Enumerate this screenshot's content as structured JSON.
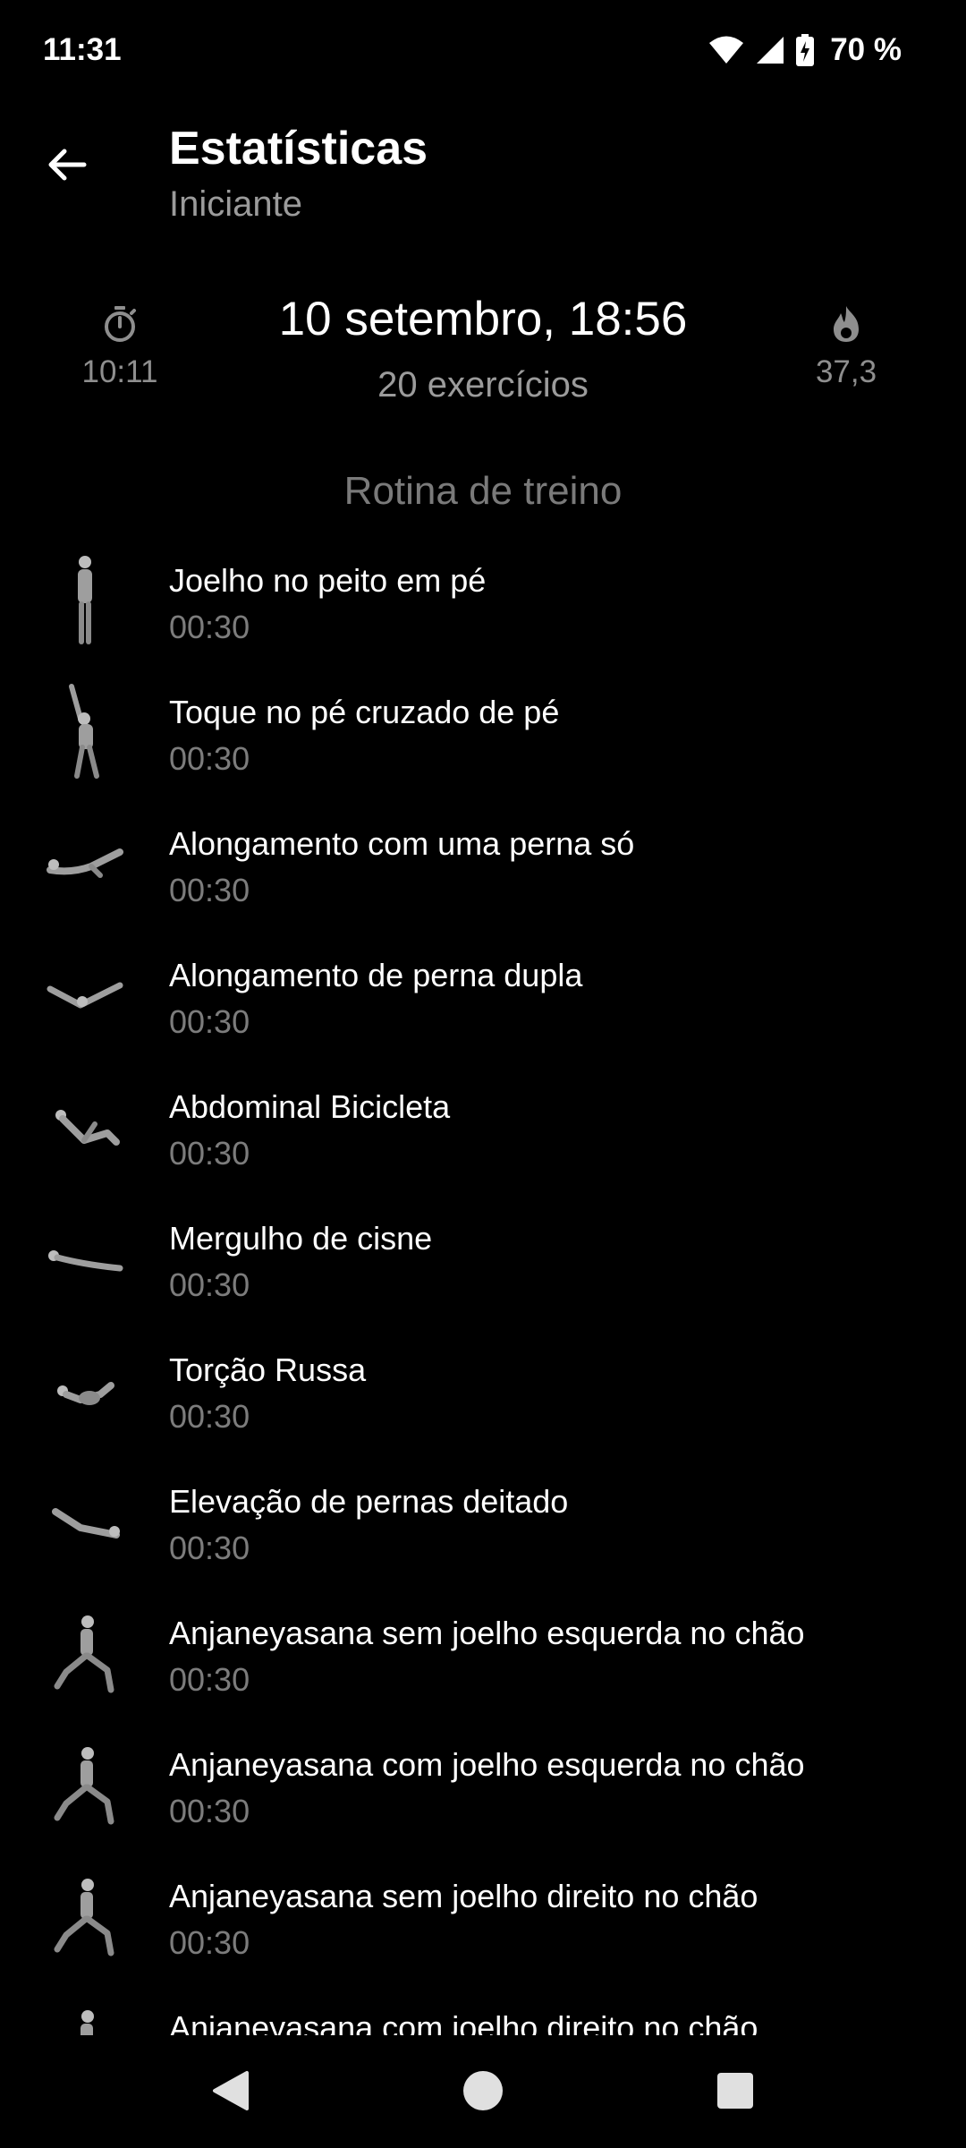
{
  "status_bar": {
    "time": "11:31",
    "battery": "70 %"
  },
  "header": {
    "title": "Estatísticas",
    "subtitle": "Iniciante"
  },
  "summary": {
    "duration": "10:11",
    "date": "10 setembro, 18:56",
    "exercise_count": "20 exercícios",
    "calories": "37,3"
  },
  "section": {
    "title": "Rotina de treino"
  },
  "exercises": [
    {
      "name": "Joelho no peito em pé",
      "duration": "00:30",
      "pose": "standing"
    },
    {
      "name": "Toque no pé cruzado de pé",
      "duration": "00:30",
      "pose": "standing-reach"
    },
    {
      "name": "Alongamento com uma perna só",
      "duration": "00:30",
      "pose": "lying-leg"
    },
    {
      "name": "Alongamento de perna dupla",
      "duration": "00:30",
      "pose": "lying-v"
    },
    {
      "name": "Abdominal Bicicleta",
      "duration": "00:30",
      "pose": "crunch"
    },
    {
      "name": "Mergulho de cisne",
      "duration": "00:30",
      "pose": "prone"
    },
    {
      "name": "Torção Russa",
      "duration": "00:30",
      "pose": "sitting-twist"
    },
    {
      "name": "Elevação de pernas deitado",
      "duration": "00:30",
      "pose": "leg-raise"
    },
    {
      "name": "Anjaneyasana sem joelho esquerda no chão",
      "duration": "00:30",
      "pose": "lunge"
    },
    {
      "name": "Anjaneyasana com joelho esquerda no chão",
      "duration": "00:30",
      "pose": "lunge"
    },
    {
      "name": "Anjaneyasana sem joelho direito no chão",
      "duration": "00:30",
      "pose": "lunge"
    },
    {
      "name": "Anjaneyasana com joelho direito no chão",
      "duration": "",
      "pose": "lunge"
    }
  ],
  "icons": {
    "back": "arrow-left-icon",
    "timer": "stopwatch-icon",
    "calories": "flame-icon",
    "wifi": "wifi-icon",
    "signal": "cell-signal-icon",
    "battery": "battery-charging-icon"
  },
  "colors": {
    "background": "#000000",
    "primary_text": "#ffffff",
    "secondary_text": "#9b9b9b",
    "muted_text": "#7c7c7c"
  }
}
